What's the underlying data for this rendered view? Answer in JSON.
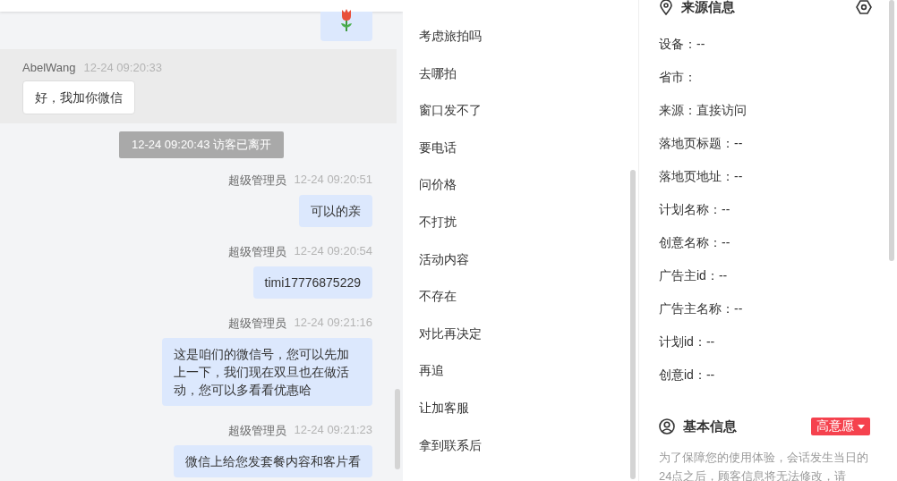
{
  "chat": {
    "messages": [
      {
        "kind": "sticker"
      },
      {
        "kind": "visitor",
        "sender": "AbelWang",
        "time": "12-24 09:20:33",
        "text": "好，我加你微信"
      },
      {
        "kind": "system",
        "text": "12-24 09:20:43 访客已离开"
      },
      {
        "kind": "agent",
        "sender": "超级管理员",
        "time": "12-24 09:20:51",
        "text": "可以的亲"
      },
      {
        "kind": "agent",
        "sender": "超级管理员",
        "time": "12-24 09:20:54",
        "text": "timi17776875229"
      },
      {
        "kind": "agent",
        "sender": "超级管理员",
        "time": "12-24 09:21:16",
        "text": "这是咱们的微信号，您可以先加上一下，我们现在双旦也在做活动，您可以多看看优惠哈"
      },
      {
        "kind": "agent",
        "sender": "超级管理员",
        "time": "12-24 09:21:23",
        "text": "微信上给您发套餐内容和客片看"
      }
    ]
  },
  "quick_replies": {
    "items": [
      "考虑旅拍吗",
      "去哪拍",
      "窗口发不了",
      "要电话",
      "问价格",
      "不打扰",
      "活动内容",
      "不存在",
      "对比再决定",
      "再追",
      "让加客服",
      "拿到联系后"
    ]
  },
  "source_info": {
    "title": "来源信息",
    "fields": [
      "设备：--",
      "省市：",
      "来源：直接访问",
      "落地页标题：--",
      "落地页地址：--",
      "计划名称：--",
      "创意名称：--",
      "广告主id：--",
      "广告主名称：--",
      "计划id：--",
      "创意id：--"
    ]
  },
  "basic_info": {
    "title": "基本信息",
    "intent_tag": {
      "label": "高意愿",
      "color": "#f5424e"
    },
    "note": "为了保障您的使用体验，会话发生当日的24点之后，顾客信息将无法修改，请"
  }
}
